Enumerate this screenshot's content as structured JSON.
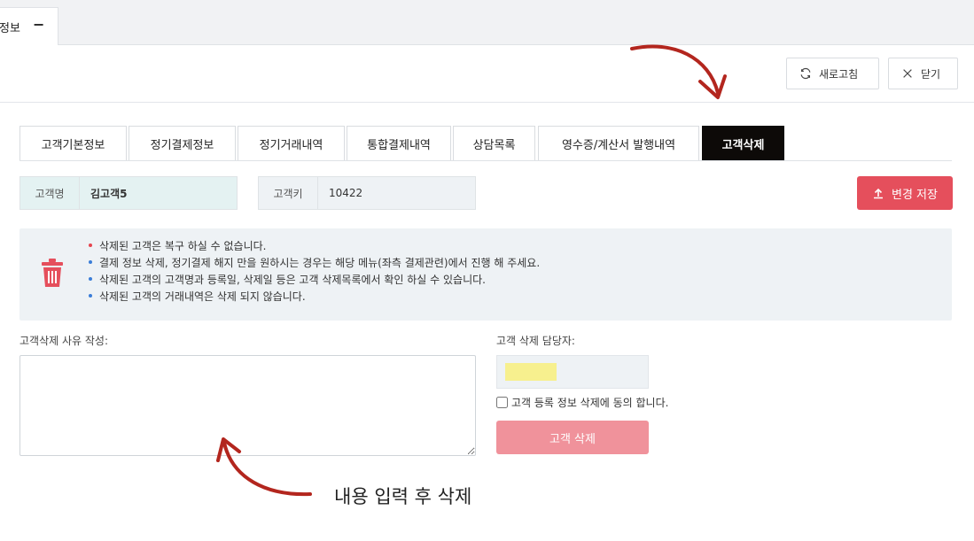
{
  "window_tab": {
    "title": "정보",
    "minimize_icon": "minus-icon"
  },
  "header": {
    "refresh_label": "새로고침",
    "close_label": "닫기"
  },
  "tabs": [
    {
      "label": "고객기본정보"
    },
    {
      "label": "정기결제정보"
    },
    {
      "label": "정기거래내역"
    },
    {
      "label": "통합결제내역"
    },
    {
      "label": "상담목록"
    },
    {
      "label": "영수증/계산서 발행내역"
    },
    {
      "label": "고객삭제"
    }
  ],
  "active_tab": "고객삭제",
  "customer": {
    "name_label": "고객명",
    "name_value": "김고객5",
    "key_label": "고객키",
    "key_value": "10422"
  },
  "save_button": {
    "label": "변경 저장",
    "color": "#e54f5c"
  },
  "notice": {
    "items": [
      {
        "text": "삭제된 고객은 복구 하실 수 없습니다.",
        "bullet_color": "#e5454f"
      },
      {
        "text": "결제 정보 삭제, 정기결제 해지 만을 원하시는 경우는 해당 메뉴(좌측 결제관련)에서 진행 해 주세요.",
        "bullet_color": "#3b7dd8"
      },
      {
        "text": "삭제된 고객의 고객명과 등록일, 삭제일 등은 고객 삭제목록에서 확인 하실 수 있습니다.",
        "bullet_color": "#3b7dd8"
      },
      {
        "text": "삭제된 고객의 거래내역은 삭제 되지 않습니다.",
        "bullet_color": "#3b7dd8"
      }
    ],
    "icon": "trash-icon"
  },
  "form": {
    "reason_label": "고객삭제 사유 작성:",
    "reason_value": "",
    "manager_label": "고객 삭제 담당자:",
    "agree_label": "고객 등록 정보 삭제에 동의 합니다.",
    "agree_checked": false,
    "delete_button": "고객 삭제"
  },
  "annotation": {
    "text": "내용 입력 후 삭제",
    "arrow_color": "#b3261e"
  }
}
